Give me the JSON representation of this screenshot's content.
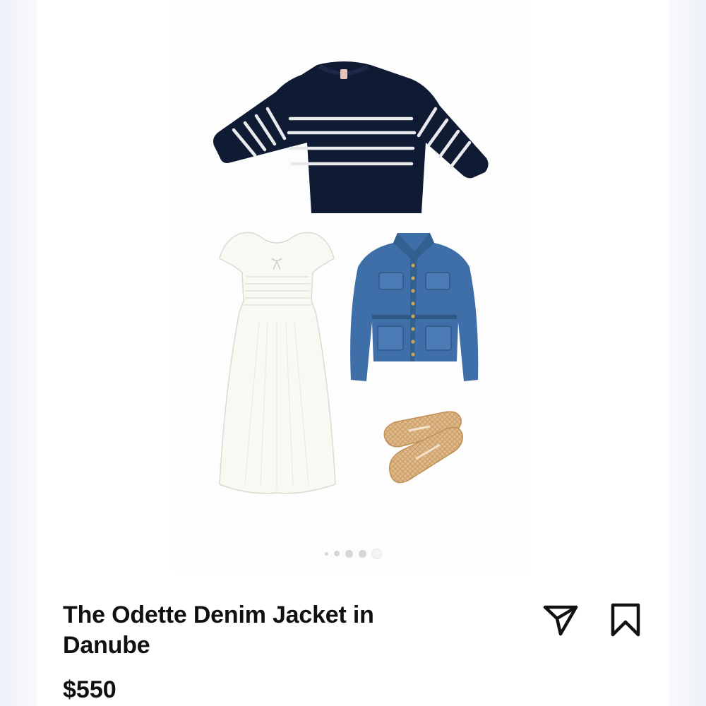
{
  "product": {
    "title": "The Odette Denim Jacket in Danube",
    "price": "$550"
  },
  "carousel": {
    "total": 5,
    "active_index": 4
  },
  "collage_items": [
    "striped-sweater",
    "white-dress",
    "denim-jacket",
    "woven-flats"
  ],
  "actions": {
    "share_icon": "paper-plane-icon",
    "save_icon": "bookmark-icon"
  },
  "colors": {
    "text": "#111111",
    "navy": "#0f1a33",
    "denim": "#3f6fa8",
    "cream": "#f9f8f3",
    "woven": "#dfb98a"
  }
}
